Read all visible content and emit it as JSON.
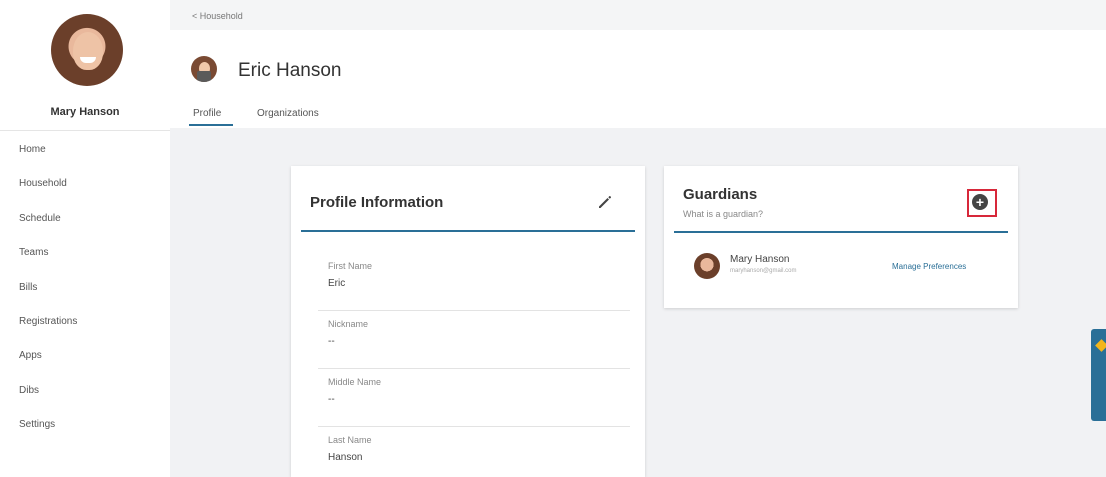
{
  "sidebar": {
    "user_name": "Mary Hanson",
    "nav": [
      "Home",
      "Household",
      "Schedule",
      "Teams",
      "Bills",
      "Registrations",
      "Apps",
      "Dibs",
      "Settings"
    ]
  },
  "breadcrumb": "< Household",
  "header": {
    "title": "Eric Hanson",
    "tabs": [
      {
        "label": "Profile",
        "active": true
      },
      {
        "label": "Organizations",
        "active": false
      }
    ]
  },
  "profile": {
    "title": "Profile Information",
    "fields": [
      {
        "label": "First Name",
        "value": "Eric"
      },
      {
        "label": "Nickname",
        "value": "--"
      },
      {
        "label": "Middle Name",
        "value": "--"
      },
      {
        "label": "Last Name",
        "value": "Hanson"
      }
    ]
  },
  "guardians": {
    "title": "Guardians",
    "subtitle": "What is a guardian?",
    "add_symbol": "+",
    "items": [
      {
        "name": "Mary Hanson",
        "email": "maryhanson@gmail.com",
        "action": "Manage Preferences"
      }
    ]
  },
  "colors": {
    "accent": "#2a6f97",
    "highlight": "#d7283a",
    "feedback": "#2a6f97"
  },
  "icons": {
    "edit": "pencil-icon",
    "add": "add-circle-icon"
  }
}
